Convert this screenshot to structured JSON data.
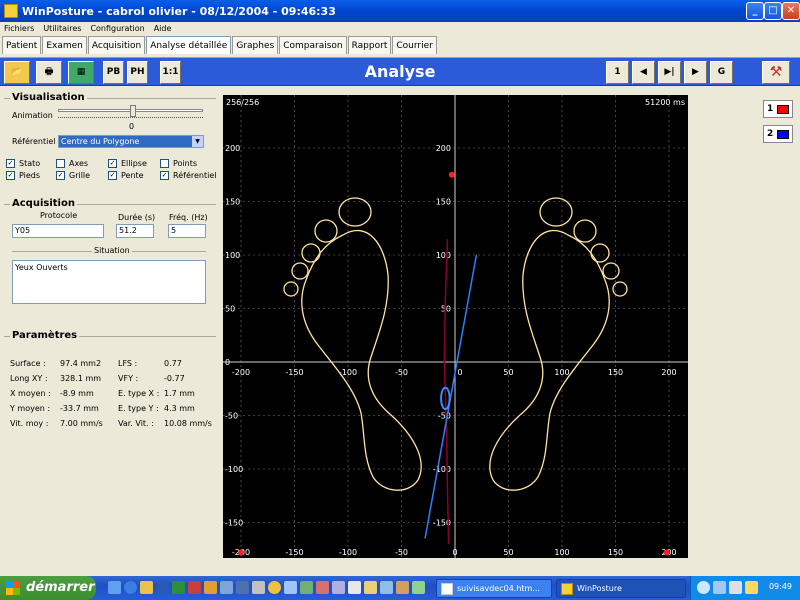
{
  "window": {
    "title": "WinPosture - cabrol olivier - 08/12/2004 - 09:46:33"
  },
  "menu": [
    "Fichiers",
    "Utilitaires",
    "Configuration",
    "Aide"
  ],
  "tabs": [
    "Patient",
    "Examen",
    "Acquisition",
    "Analyse détaillée",
    "Graphes",
    "Comparaison",
    "Rapport",
    "Courrier"
  ],
  "active_tab": "Analyse détaillée",
  "toolbar": {
    "title": "Analyse",
    "left_buttons": [
      "open-icon",
      "print-icon",
      "calculator-icon"
    ],
    "pb": "PB",
    "ph": "PH",
    "ratio": "1:1",
    "nav": {
      "first": "1",
      "prev": "◀",
      "play_end": "▶|",
      "next": "▶",
      "goto": "G"
    },
    "exit_icon": "exit-icon"
  },
  "visualisation": {
    "title": "Visualisation",
    "animation_label": "Animation",
    "animation_value": "0",
    "referentiel_label": "Référentiel",
    "referentiel_value": "Centre du Polygone",
    "options": [
      {
        "label": "Stato",
        "checked": true
      },
      {
        "label": "Axes",
        "checked": false
      },
      {
        "label": "Ellipse",
        "checked": true
      },
      {
        "label": "Points",
        "checked": false
      },
      {
        "label": "Pieds",
        "checked": true
      },
      {
        "label": "Grille",
        "checked": true
      },
      {
        "label": "Pente",
        "checked": true
      },
      {
        "label": "Référentiel",
        "checked": true
      }
    ]
  },
  "acquisition": {
    "title": "Acquisition",
    "protocole_label": "Protocole",
    "duree_label": "Durée (s)",
    "freq_label": "Fréq. (Hz)",
    "protocole": "Y05",
    "duree": "51.2",
    "freq": "5",
    "situation_label": "Situation",
    "situation": "Yeux Ouverts"
  },
  "parametres": {
    "title": "Paramètres",
    "left": [
      {
        "label": "Surface :",
        "value": "97.4 mm2"
      },
      {
        "label": "Long XY :",
        "value": "328.1 mm"
      },
      {
        "label": "X moyen :",
        "value": "-8.9 mm"
      },
      {
        "label": "Y moyen :",
        "value": "-33.7 mm"
      },
      {
        "label": "Vit. moy :",
        "value": "7.00 mm/s"
      }
    ],
    "right": [
      {
        "label": "LFS :",
        "value": "0.77"
      },
      {
        "label": "VFY :",
        "value": "-0.77"
      },
      {
        "label": "E. type X :",
        "value": "1.7 mm"
      },
      {
        "label": "E. type Y :",
        "value": "4.3 mm"
      },
      {
        "label": "Var. Vit. :",
        "value": "10.08 mm/s"
      }
    ]
  },
  "chart_data": {
    "type": "scatter",
    "title": "",
    "corner_left": "256/256",
    "corner_right": "51200 ms",
    "xlim": [
      -210,
      210
    ],
    "ylim": [
      -200,
      200
    ],
    "grid": true,
    "outer_x_ticks": [
      "-200",
      "-150",
      "-100",
      "-50",
      "0",
      "50",
      "100",
      "150",
      "200"
    ],
    "outer_y_ticks": [
      "200",
      "150",
      "100",
      "50",
      "0",
      "-50",
      "-100",
      "-150",
      "-200"
    ],
    "inner_x_ticks": [
      "-200",
      "-150",
      "-100",
      "-50",
      "0",
      "50",
      "100",
      "150",
      "200"
    ],
    "inner_y_ticks": [
      "200",
      "150",
      "100",
      "50",
      "-50",
      "-100",
      "-150"
    ],
    "ellipse": {
      "cx": -9,
      "cy": -34,
      "rx": 4,
      "ry": 10
    },
    "slope_line": [
      [
        -28,
        -165
      ],
      [
        20,
        100
      ]
    ],
    "stato_trace": [
      [
        -7,
        115
      ],
      [
        -9,
        60
      ],
      [
        -10,
        0
      ],
      [
        -9,
        -30
      ],
      [
        -8,
        -60
      ],
      [
        -7,
        -120
      ],
      [
        -6,
        -170
      ]
    ],
    "ref_points": [
      [
        -3,
        175
      ],
      [
        -200,
        -178
      ],
      [
        198,
        -178
      ]
    ],
    "legend": [
      {
        "label": "1",
        "color": "#ff0000"
      },
      {
        "label": "2",
        "color": "#0000ff"
      }
    ]
  },
  "taskbar": {
    "start": "démarrer",
    "tasks": [
      {
        "label": "suivisavdec04.htm...",
        "active": false
      },
      {
        "label": "WinPosture",
        "active": true
      }
    ],
    "clock": "09:49"
  }
}
